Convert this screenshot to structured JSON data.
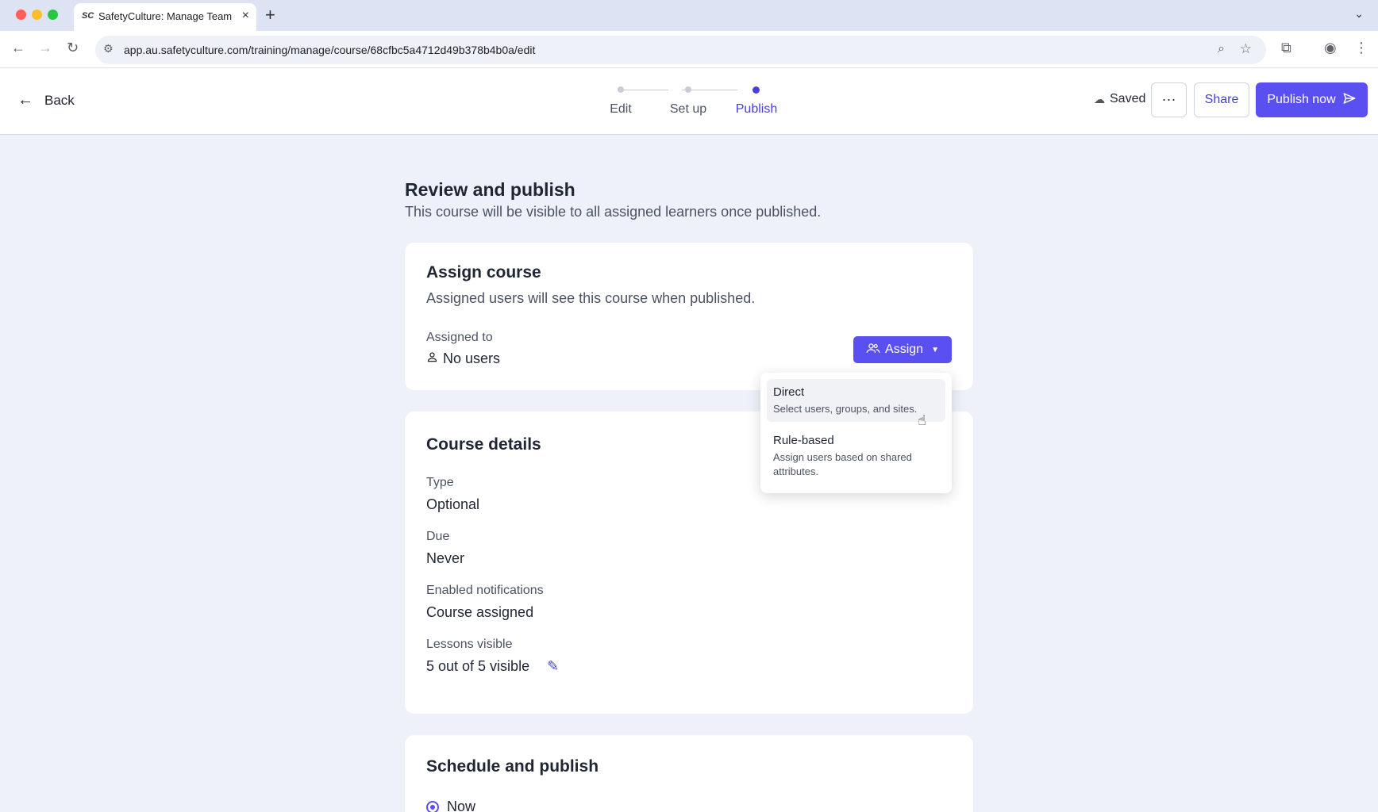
{
  "browser": {
    "tab_title": "SafetyCulture: Manage Teams",
    "tab_favicon": "SC",
    "url": "app.au.safetyculture.com/training/manage/course/68cfbc5a4712d49b378b4b0a/edit"
  },
  "header": {
    "back_label": "Back",
    "steps": [
      {
        "label": "Edit",
        "state": "done"
      },
      {
        "label": "Set up",
        "state": "done"
      },
      {
        "label": "Publish",
        "state": "active"
      }
    ],
    "saved_label": "Saved",
    "more_label": "···",
    "share_label": "Share",
    "publish_label": "Publish now"
  },
  "page": {
    "title": "Review and publish",
    "subtitle": "This course will be visible to all assigned learners once published."
  },
  "assign_card": {
    "title": "Assign course",
    "subtitle": "Assigned users will see this course when published.",
    "assigned_label": "Assigned to",
    "assigned_value": "No users",
    "assign_button": "Assign"
  },
  "assign_menu": {
    "items": [
      {
        "title": "Direct",
        "desc": "Select users, groups, and sites."
      },
      {
        "title": "Rule-based",
        "desc": "Assign users based on shared attributes."
      }
    ]
  },
  "details_card": {
    "title": "Course details",
    "fields": [
      {
        "label": "Type",
        "value": "Optional"
      },
      {
        "label": "Due",
        "value": "Never"
      },
      {
        "label": "Enabled notifications",
        "value": "Course assigned"
      },
      {
        "label": "Lessons visible",
        "value": "5 out of 5 visible"
      }
    ]
  },
  "schedule_card": {
    "title": "Schedule and publish",
    "option_now": "Now"
  },
  "colors": {
    "accent": "#5a4ff0",
    "accent_text": "#4740d4",
    "background": "#eef1f9"
  }
}
